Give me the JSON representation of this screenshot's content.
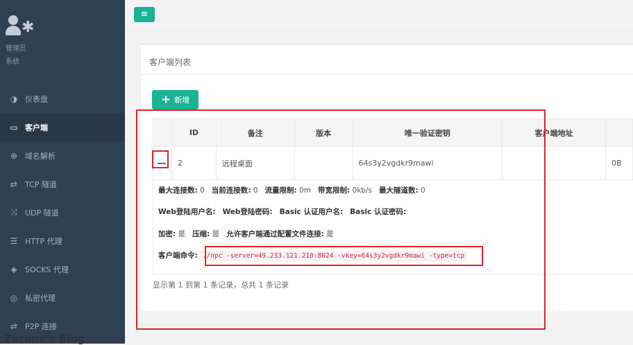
{
  "sidebar": {
    "user_name": "管理员",
    "user_role": "系统",
    "items": [
      {
        "label": "仪表盘",
        "icon": "dashboard-icon",
        "glyph": "◑"
      },
      {
        "label": "客户端",
        "icon": "monitor-icon",
        "glyph": "▭",
        "active": true
      },
      {
        "label": "域名解析",
        "icon": "globe-icon",
        "glyph": "⊕"
      },
      {
        "label": "TCP 隧道",
        "icon": "tunnel-icon",
        "glyph": "⇄"
      },
      {
        "label": "UDP 隧道",
        "icon": "shuffle-icon",
        "glyph": "⤨"
      },
      {
        "label": "HTTP 代理",
        "icon": "server-icon",
        "glyph": "☰"
      },
      {
        "label": "SOCKS 代理",
        "icon": "layers-icon",
        "glyph": "◈"
      },
      {
        "label": "私密代理",
        "icon": "eye-slash-icon",
        "glyph": "◎"
      },
      {
        "label": "P2P 连接",
        "icon": "exchange-icon",
        "glyph": "⇄"
      }
    ],
    "watermark": "Zerune's Blog"
  },
  "topbar": {
    "menu_icon": "hamburger-icon"
  },
  "panel": {
    "title": "客户端列表",
    "add_label": "新增",
    "table": {
      "columns": [
        "",
        "ID",
        "备注",
        "版本",
        "唯一验证密钥",
        "客户端地址",
        ""
      ],
      "rows": [
        {
          "expand": "−",
          "id": "2",
          "remark": "远程桌面",
          "version": "",
          "key": "64s3y2vgdkr9mawi",
          "addr": "",
          "traffic": "0B"
        }
      ]
    },
    "detail": {
      "line1": [
        {
          "k": "最大连接数:",
          "v": " 0"
        },
        {
          "k": "当前连接数:",
          "v": " 0"
        },
        {
          "k": "流量限制:",
          "v": " 0m"
        },
        {
          "k": "带宽限制:",
          "v": " 0kb/s"
        },
        {
          "k": "最大隧道数:",
          "v": " 0"
        }
      ],
      "line2": [
        "Web登陆用户名:",
        "Web登陆密码:",
        "Basic 认证用户名:",
        "Basic 认证密码:"
      ],
      "line3": [
        {
          "k": "加密:",
          "v": " 是"
        },
        {
          "k": "压缩:",
          "v": " 是"
        },
        {
          "k": "允许客户端通过配置文件连接:",
          "v": " 是"
        }
      ],
      "cmd_label": "客户端命令:",
      "cmd_value": "./npc -server=49.233.121.210:8024 -vkey=64s3y2vgdkr9mawi -type=tcp"
    },
    "pagination_info": "显示第 1 到第 1 条记录，总共 1 条记录"
  },
  "annotation_color": "#e0212a"
}
